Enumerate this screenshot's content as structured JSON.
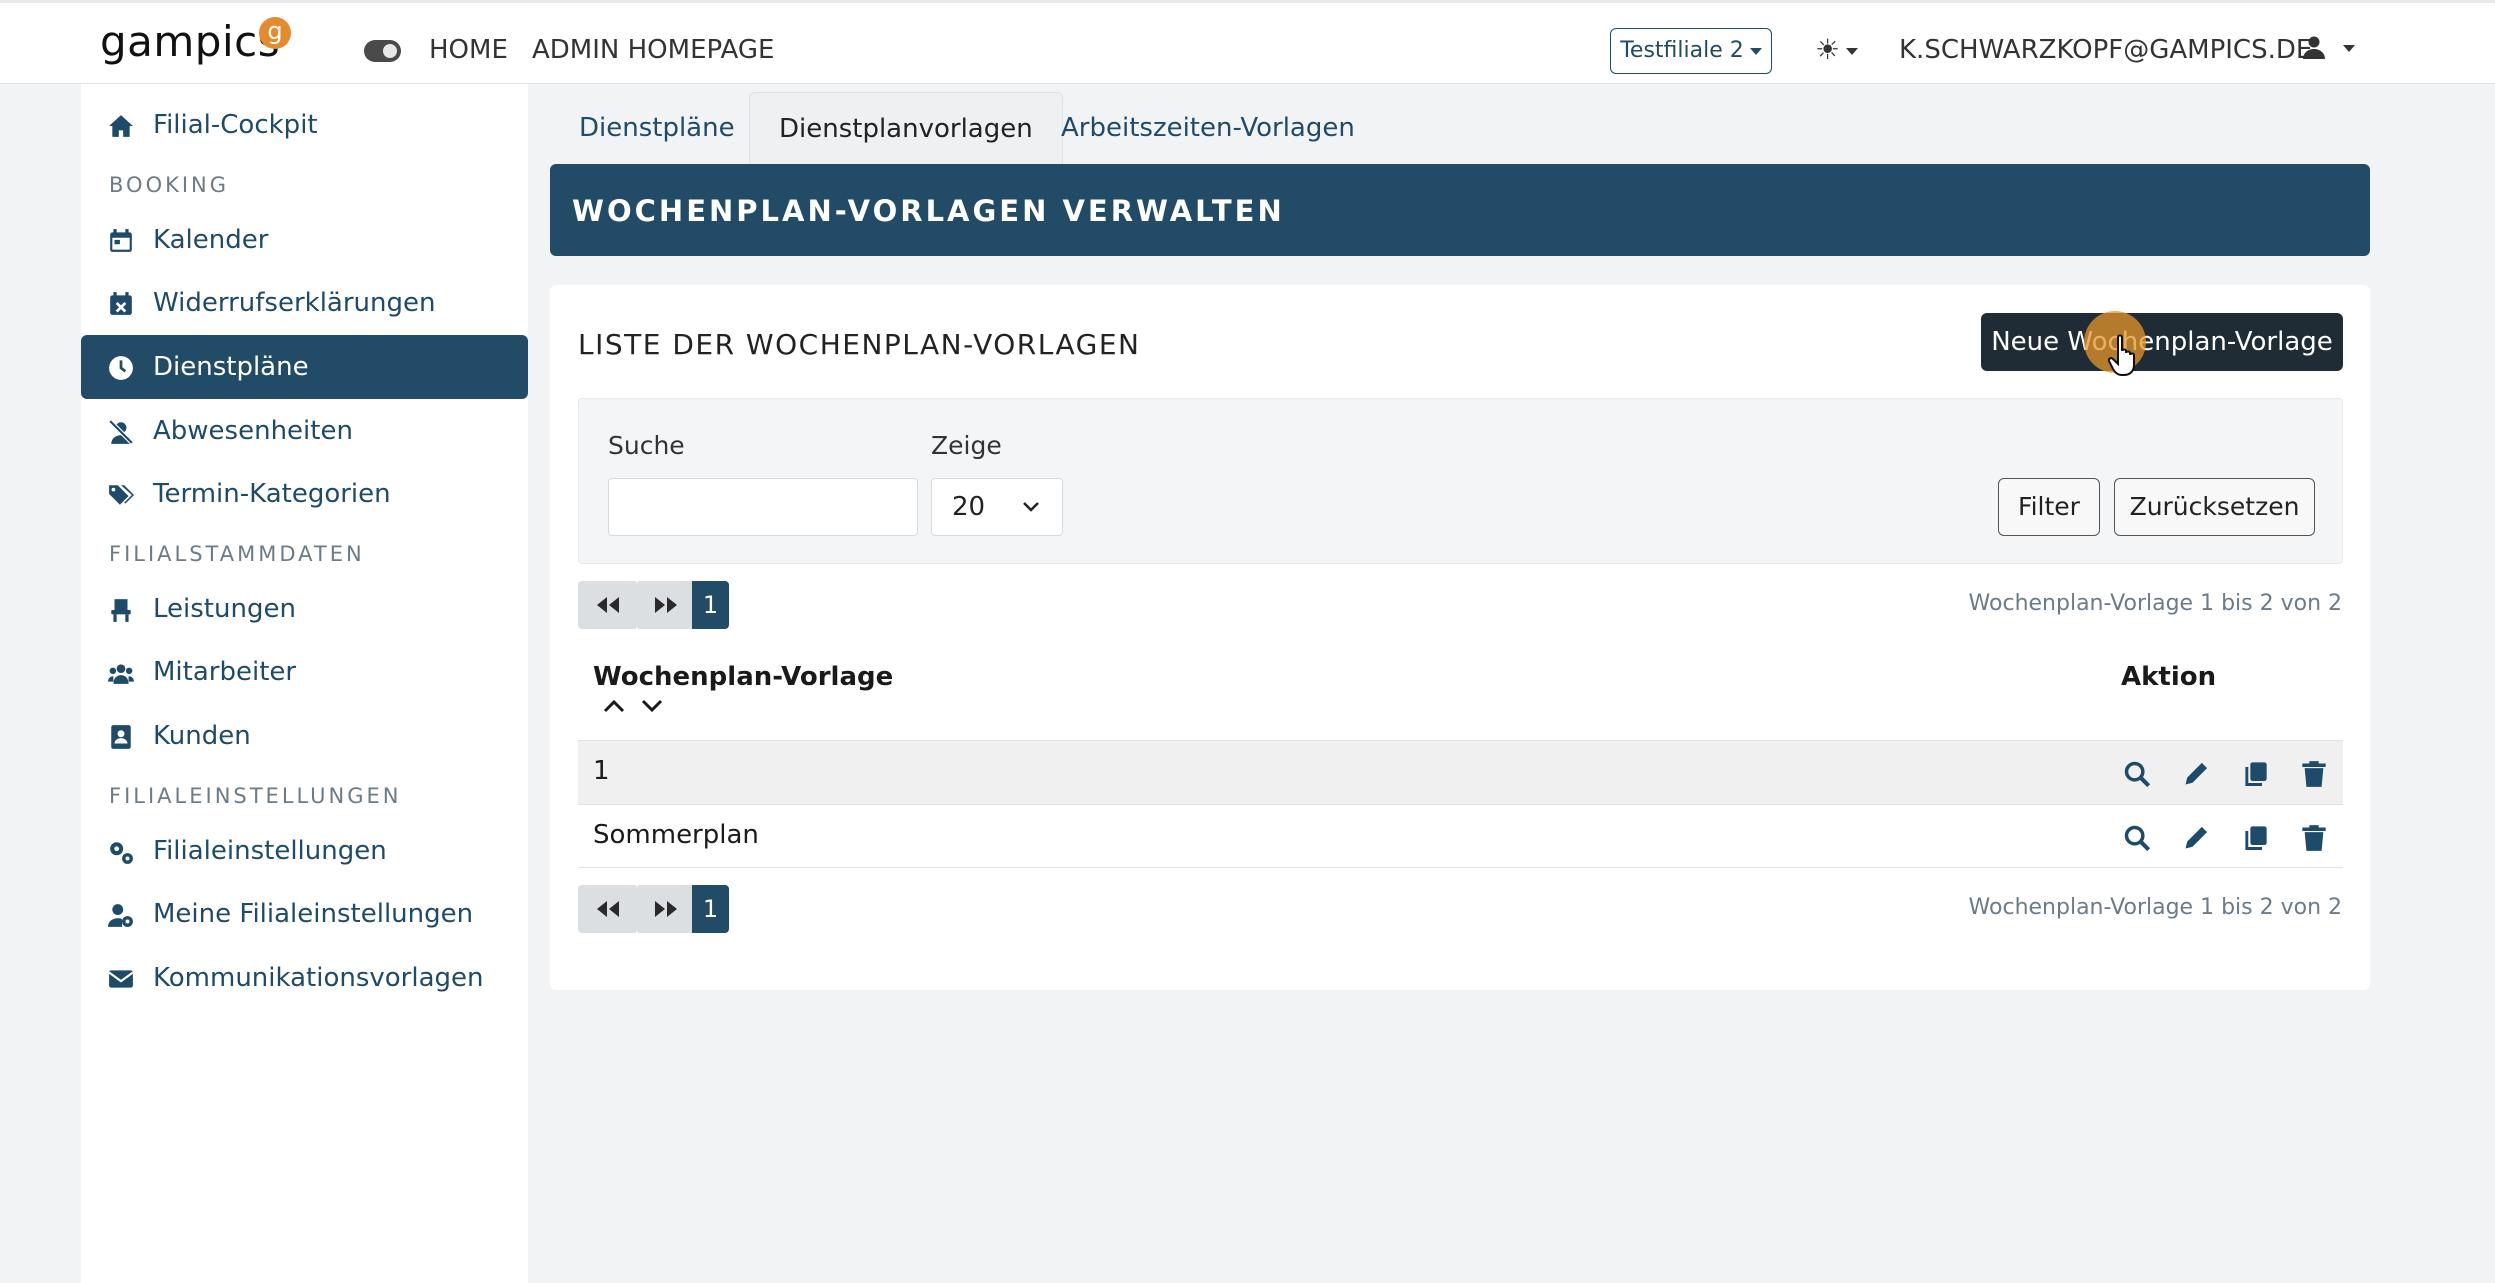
{
  "header": {
    "logo_text": "gampics",
    "logo_badge": "g",
    "nav": [
      "HOME",
      "ADMIN HOMEPAGE"
    ],
    "branch_select": "Testfiliale 2",
    "user_email": "K.SCHWARZKOPF@GAMPICS.DE"
  },
  "sidebar": {
    "items": [
      {
        "label": "Filial-Cockpit",
        "icon": "home-icon"
      },
      {
        "label": "Kalender",
        "icon": "calendar-icon"
      },
      {
        "label": "Widerrufserklärungen",
        "icon": "calendar-x-icon"
      },
      {
        "label": "Dienstpläne",
        "icon": "clock-icon",
        "active": true
      },
      {
        "label": "Abwesenheiten",
        "icon": "user-slash-icon"
      },
      {
        "label": "Termin-Kategorien",
        "icon": "tags-icon"
      },
      {
        "label": "Leistungen",
        "icon": "chair-icon"
      },
      {
        "label": "Mitarbeiter",
        "icon": "users-icon"
      },
      {
        "label": "Kunden",
        "icon": "contact-book-icon"
      },
      {
        "label": "Filialeinstellungen",
        "icon": "gears-icon"
      },
      {
        "label": "Meine Filialeinstellungen",
        "icon": "user-gear-icon"
      },
      {
        "label": "Kommunikationsvorlagen",
        "icon": "envelope-icon"
      }
    ],
    "headings": [
      "BOOKING",
      "FILIALSTAMMDATEN",
      "FILIALEINSTELLUNGEN"
    ]
  },
  "tabs": [
    {
      "label": "Dienstpläne"
    },
    {
      "label": "Dienstplanvorlagen",
      "active": true
    },
    {
      "label": "Arbeitszeiten-Vorlagen"
    }
  ],
  "banner": {
    "title": "WOCHENPLAN-VORLAGEN VERWALTEN"
  },
  "card": {
    "title": "LISTE DER WOCHENPLAN-VORLAGEN",
    "new_button": "Neue Wochenplan-Vorlage"
  },
  "filters": {
    "search_label": "Suche",
    "search_value": "",
    "show_label": "Zeige",
    "show_value": "20",
    "filter_button": "Filter",
    "reset_button": "Zurücksetzen"
  },
  "pagination": {
    "current_page": "1",
    "info": "Wochenplan-Vorlage 1 bis 2 von 2"
  },
  "table": {
    "columns": [
      "Wochenplan-Vorlage",
      "Aktion"
    ],
    "rows": [
      {
        "name": "1"
      },
      {
        "name": "Sommerplan"
      }
    ],
    "actions": [
      "search-icon",
      "pencil-icon",
      "copy-icon",
      "trash-icon"
    ]
  },
  "colors": {
    "primary": "#214b66",
    "accent": "#e68a2e",
    "dark_button": "#1f2c35"
  }
}
